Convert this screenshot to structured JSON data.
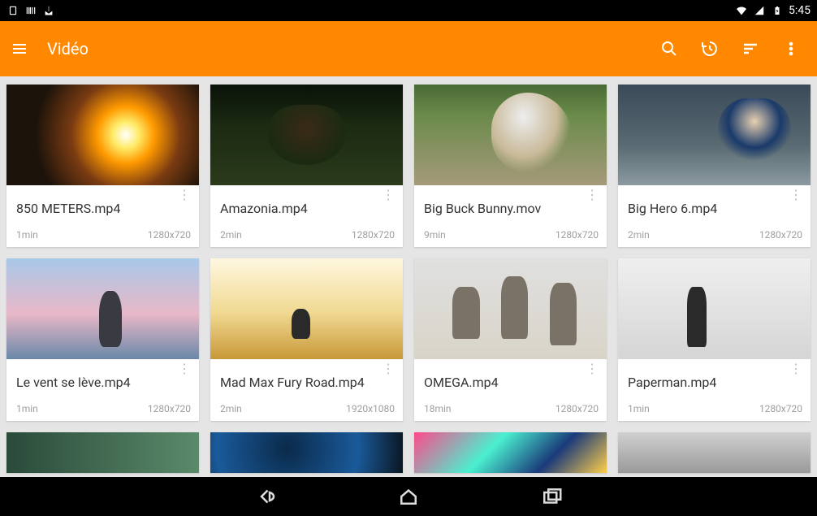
{
  "statusbar": {
    "time": "5:45"
  },
  "toolbar": {
    "title": "Vidéo"
  },
  "videos": [
    {
      "title": "850 METERS.mp4",
      "duration": "1min",
      "resolution": "1280x720"
    },
    {
      "title": "Amazonia.mp4",
      "duration": "2min",
      "resolution": "1280x720"
    },
    {
      "title": "Big Buck Bunny.mov",
      "duration": "9min",
      "resolution": "1280x720"
    },
    {
      "title": "Big Hero 6.mp4",
      "duration": "2min",
      "resolution": "1280x720"
    },
    {
      "title": "Le vent se lève.mp4",
      "duration": "1min",
      "resolution": "1280x720"
    },
    {
      "title": "Mad Max Fury Road.mp4",
      "duration": "2min",
      "resolution": "1920x1080"
    },
    {
      "title": "OMEGA.mp4",
      "duration": "18min",
      "resolution": "1280x720"
    },
    {
      "title": "Paperman.mp4",
      "duration": "1min",
      "resolution": "1280x720"
    }
  ],
  "colors": {
    "accent": "#ff8800"
  }
}
